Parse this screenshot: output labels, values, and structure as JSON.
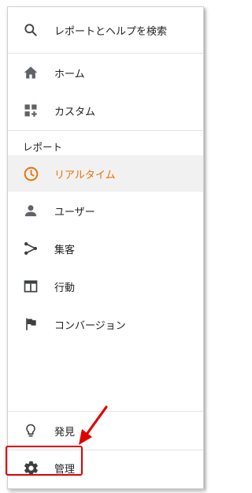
{
  "search": {
    "label": "レポートとヘルプを検索",
    "icon": "search-icon"
  },
  "nav": {
    "home": {
      "label": "ホーム",
      "icon": "home-icon"
    },
    "custom": {
      "label": "カスタム",
      "icon": "dashboard-add-icon"
    }
  },
  "reports": {
    "header": "レポート",
    "items": [
      {
        "label": "リアルタイム",
        "icon": "clock-icon",
        "active": true
      },
      {
        "label": "ユーザー",
        "icon": "person-icon"
      },
      {
        "label": "集客",
        "icon": "acquisition-icon"
      },
      {
        "label": "行動",
        "icon": "window-icon"
      },
      {
        "label": "コンバージョン",
        "icon": "flag-icon"
      }
    ]
  },
  "footer": {
    "discover": {
      "label": "発見",
      "icon": "lightbulb-icon"
    },
    "admin": {
      "label": "管理",
      "icon": "gear-icon"
    }
  },
  "colors": {
    "active": "#e8710a",
    "icon": "#5f6368",
    "annotation": "#e00000"
  }
}
